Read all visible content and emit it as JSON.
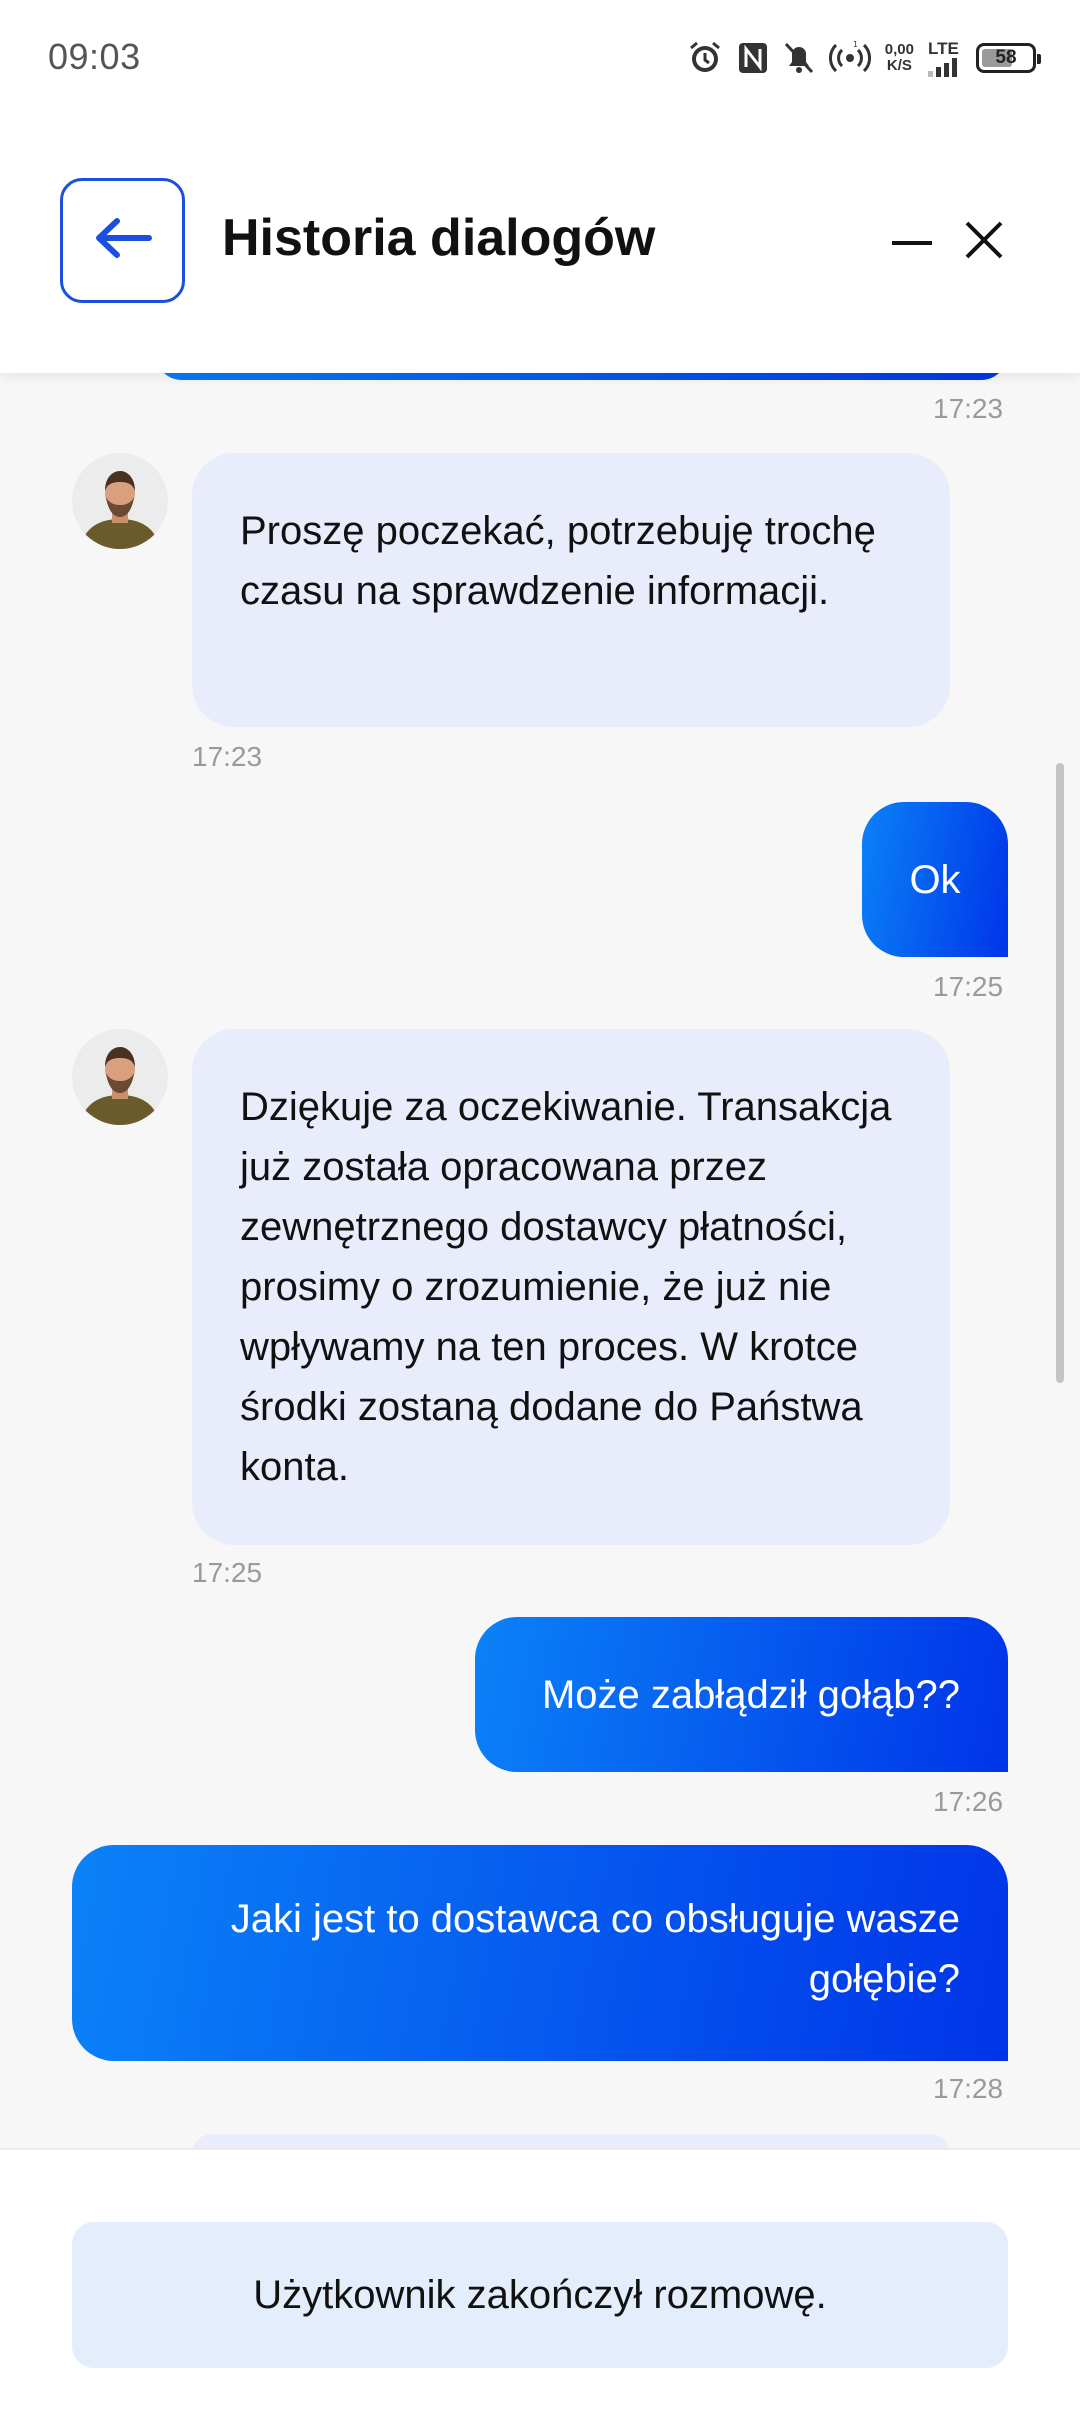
{
  "status_bar": {
    "time": "09:03",
    "net_speed_value": "0,00",
    "net_speed_unit": "K/S",
    "network": "LTE",
    "battery": "58",
    "icons": [
      "alarm-icon",
      "nfc-icon",
      "silent-bell-icon",
      "hotspot-icon",
      "signal-icon",
      "battery-icon"
    ]
  },
  "header": {
    "title": "Historia dialogów",
    "back_icon": "arrow-left-icon",
    "minimize_icon": "minimize-icon",
    "close_icon": "close-icon"
  },
  "colors": {
    "accent": "#1a4fe0",
    "outgoing_gradient_start": "#0b82f7",
    "outgoing_gradient_end": "#0034e8",
    "incoming_bubble": "#e9edfb",
    "notice_bg": "#e4edfb"
  },
  "messages": [
    {
      "direction": "out",
      "text": "",
      "time": "17:23",
      "partial": true
    },
    {
      "direction": "in",
      "text": "Proszę poczekać, potrzebuję trochę czasu na sprawdzenie informacji.",
      "time": "17:23"
    },
    {
      "direction": "out",
      "text": "Ok",
      "time": "17:25"
    },
    {
      "direction": "in",
      "text": "Dziękuje za oczekiwanie. Transakcja już została opracowana przez zewnętrznego dostawcy płatności, prosimy o zrozumienie, że już nie wpływamy na ten proces. W krotce środki zostaną dodane do Państwa konta.",
      "time": "17:25"
    },
    {
      "direction": "out",
      "text": "Może zabłądził gołąb??",
      "time": "17:26"
    },
    {
      "direction": "out",
      "text": "Jaki jest to dostawca co obsługuje wasze gołębie?",
      "time": "17:28"
    }
  ],
  "footer": {
    "notice": "Użytkownik zakończył rozmowę."
  }
}
